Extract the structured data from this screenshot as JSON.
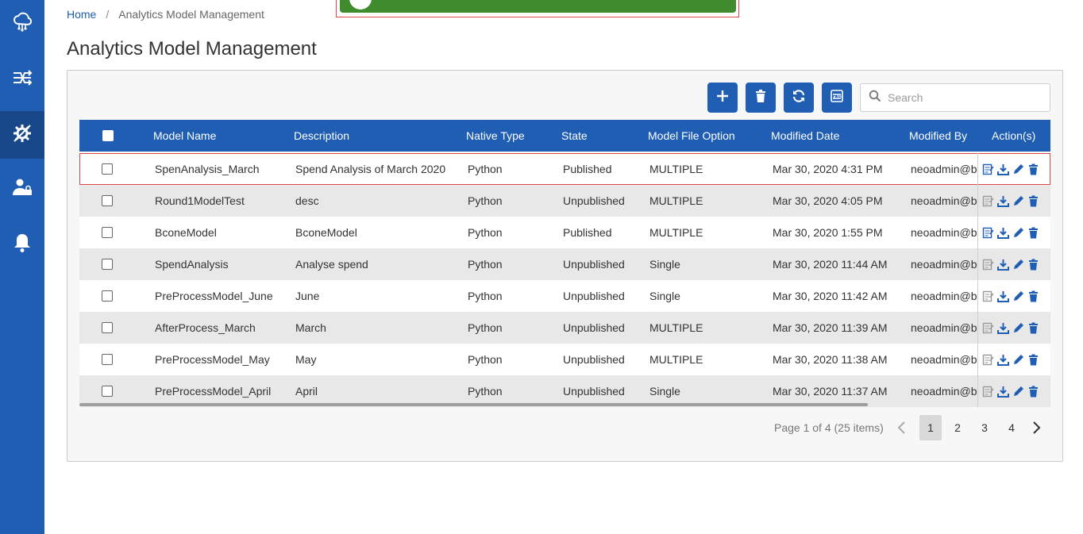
{
  "sidebar": {
    "items": [
      {
        "name": "cloud-network-icon"
      },
      {
        "name": "workflow-icon"
      },
      {
        "name": "model-gear-icon",
        "active": true
      },
      {
        "name": "user-lock-icon"
      },
      {
        "name": "bell-icon"
      }
    ]
  },
  "breadcrumb": {
    "home": "Home",
    "separator": "/",
    "current": "Analytics Model Management"
  },
  "page_title": "Analytics Model Management",
  "toolbar": {
    "buttons": [
      "plus-icon",
      "trash-icon",
      "refresh-icon",
      "xlsx-export-icon"
    ],
    "search_placeholder": "Search"
  },
  "table": {
    "headers": {
      "model_name": "Model Name",
      "description": "Description",
      "native_type": "Native Type",
      "state": "State",
      "model_file_option": "Model File Option",
      "modified_date": "Modified Date",
      "modified_by": "Modified By",
      "actions": "Action(s)"
    },
    "rows": [
      {
        "model_name": "SpenAnalysis_March",
        "description": "Spend Analysis of March 2020",
        "native_type": "Python",
        "state": "Published",
        "model_file_option": "MULTIPLE",
        "modified_date": "Mar 30, 2020 4:31 PM",
        "modified_by": "neoadmin@bo"
      },
      {
        "model_name": "Round1ModelTest",
        "description": "desc",
        "native_type": "Python",
        "state": "Unpublished",
        "model_file_option": "MULTIPLE",
        "modified_date": "Mar 30, 2020 4:05 PM",
        "modified_by": "neoadmin@bo"
      },
      {
        "model_name": "BconeModel",
        "description": "BconeModel",
        "native_type": "Python",
        "state": "Published",
        "model_file_option": "MULTIPLE",
        "modified_date": "Mar 30, 2020 1:55 PM",
        "modified_by": "neoadmin@bo"
      },
      {
        "model_name": "SpendAnalysis",
        "description": "Analyse spend",
        "native_type": "Python",
        "state": "Unpublished",
        "model_file_option": "Single",
        "modified_date": "Mar 30, 2020 11:44 AM",
        "modified_by": "neoadmin@bo"
      },
      {
        "model_name": "PreProcessModel_June",
        "description": "June",
        "native_type": "Python",
        "state": "Unpublished",
        "model_file_option": "Single",
        "modified_date": "Mar 30, 2020 11:42 AM",
        "modified_by": "neoadmin@bo"
      },
      {
        "model_name": "AfterProcess_March",
        "description": "March",
        "native_type": "Python",
        "state": "Unpublished",
        "model_file_option": "MULTIPLE",
        "modified_date": "Mar 30, 2020 11:39 AM",
        "modified_by": "neoadmin@bo"
      },
      {
        "model_name": "PreProcessModel_May",
        "description": "May",
        "native_type": "Python",
        "state": "Unpublished",
        "model_file_option": "MULTIPLE",
        "modified_date": "Mar 30, 2020 11:38 AM",
        "modified_by": "neoadmin@bo"
      },
      {
        "model_name": "PreProcessModel_April",
        "description": "April",
        "native_type": "Python",
        "state": "Unpublished",
        "model_file_option": "Single",
        "modified_date": "Mar 30, 2020 11:37 AM",
        "modified_by": "neoadmin@bo"
      }
    ]
  },
  "pagination": {
    "info": "Page 1 of 4 (25 items)",
    "pages": [
      "1",
      "2",
      "3",
      "4"
    ],
    "current": "1"
  },
  "colors": {
    "primary": "#1f5eb2",
    "toast": "#3f8b2e",
    "highlight": "#e04848"
  }
}
